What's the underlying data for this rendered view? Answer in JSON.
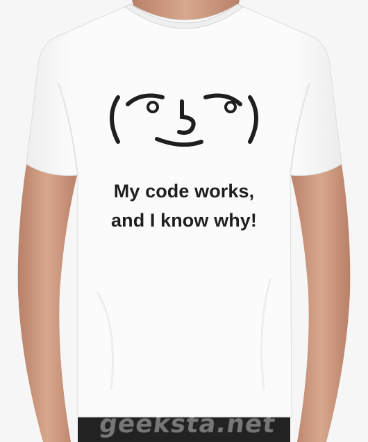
{
  "shirt": {
    "slogan": {
      "line1": "My code works,",
      "line2": "and I know why!"
    },
    "face_emoticon": "( ͡° ͜ʖ ͡°)",
    "colors": {
      "shirt": "#fbfbfb",
      "ink": "#1f1f1f",
      "skin": "#c89478",
      "pants": "#222222"
    }
  },
  "watermark": {
    "text": "geeksta.net"
  }
}
